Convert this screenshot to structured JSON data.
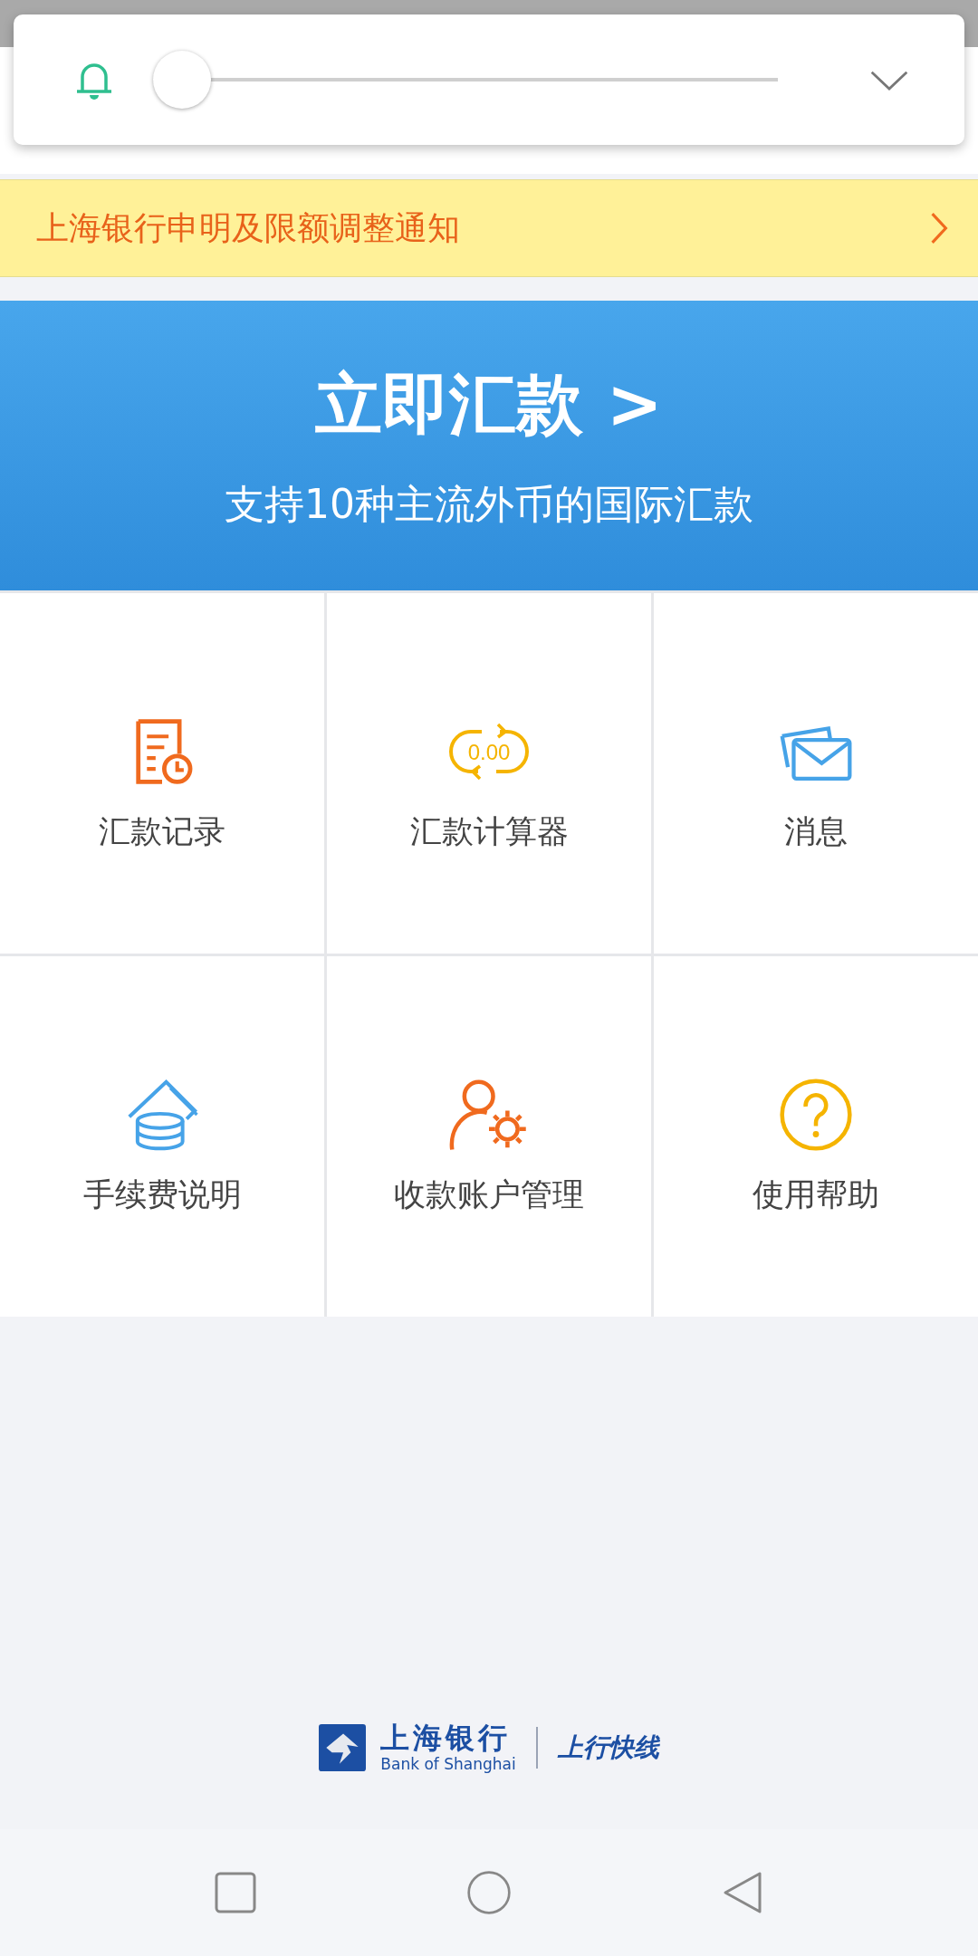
{
  "volume_panel": {
    "level": 0
  },
  "notice": {
    "text": "上海银行申明及限额调整通知"
  },
  "banner": {
    "title": "立即汇款 >",
    "subtitle": "支持10种主流外币的国际汇款"
  },
  "grid": [
    {
      "kind": "record",
      "label": "汇款记录"
    },
    {
      "kind": "calculator",
      "label": "汇款计算器",
      "icon_text": "0.00"
    },
    {
      "kind": "message",
      "label": "消息"
    },
    {
      "kind": "fee",
      "label": "手续费说明"
    },
    {
      "kind": "account",
      "label": "收款账户管理"
    },
    {
      "kind": "help",
      "label": "使用帮助"
    }
  ],
  "footer_logo": {
    "name": "上海银行",
    "english": "Bank of Shanghai",
    "product": "上行快线"
  }
}
